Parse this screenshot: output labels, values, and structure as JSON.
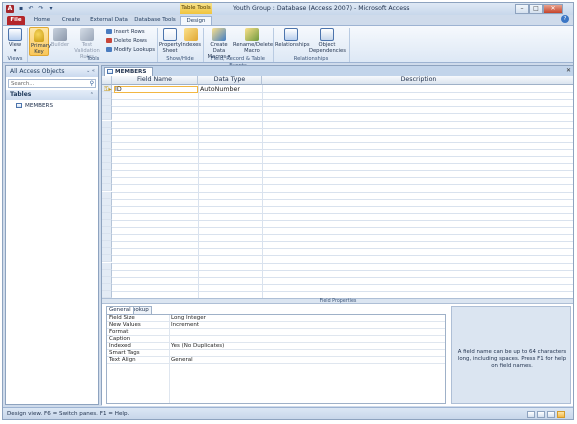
{
  "window": {
    "title": "Youth Group : Database (Access 2007) - Microsoft Access",
    "context_tab": "Table Tools",
    "app_icon": "A",
    "controls": {
      "minimize": "–",
      "maximize": "□",
      "close": "✕"
    }
  },
  "ribbon_tabs": [
    {
      "label": "File"
    },
    {
      "label": "Home"
    },
    {
      "label": "Create"
    },
    {
      "label": "External Data"
    },
    {
      "label": "Database Tools"
    },
    {
      "label": "Design"
    }
  ],
  "ribbon": {
    "views": {
      "view_label": "View",
      "group_label": "Views"
    },
    "tools": {
      "primary_key": "Primary Key",
      "builder": "Builder",
      "test_validation": "Test Validation Rules",
      "insert_rows": "Insert Rows",
      "delete_rows": "Delete Rows",
      "modify_lookups": "Modify Lookups",
      "group_label": "Tools"
    },
    "show_hide": {
      "property_sheet": "Property Sheet",
      "indexes": "Indexes",
      "group_label": "Show/Hide"
    },
    "field_events": {
      "create_macros": "Create Data Macros ▾",
      "rename_delete": "Rename/Delete Macro",
      "group_label": "Field, Record & Table Events"
    },
    "relationships": {
      "relationships": "Relationships",
      "object_dependencies": "Object Dependencies",
      "group_label": "Relationships"
    }
  },
  "nav": {
    "header": "All Access Objects",
    "header_tools": "⌄ «",
    "search_placeholder": "Search...",
    "group": "Tables",
    "group_chevron": "⌃",
    "items": [
      {
        "label": "MEMBERS"
      }
    ]
  },
  "document": {
    "tab_label": "MEMBERS",
    "close": "✕",
    "columns": [
      "Field Name",
      "Data Type",
      "Description"
    ],
    "rows": [
      {
        "field_name": "ID",
        "data_type": "AutoNumber",
        "description": ""
      }
    ]
  },
  "field_properties": {
    "bar_label": "Field Properties",
    "tabs": [
      "General",
      "Lookup"
    ],
    "rows": [
      {
        "label": "Field Size",
        "value": "Long Integer"
      },
      {
        "label": "New Values",
        "value": "Increment"
      },
      {
        "label": "Format",
        "value": ""
      },
      {
        "label": "Caption",
        "value": ""
      },
      {
        "label": "Indexed",
        "value": "Yes (No Duplicates)"
      },
      {
        "label": "Smart Tags",
        "value": ""
      },
      {
        "label": "Text Align",
        "value": "General"
      }
    ],
    "help_text": "A field name can be up to 64 characters long, including spaces. Press F1 for help on field names."
  },
  "status": {
    "text": "Design view.  F6 = Switch panes.  F1 = Help."
  },
  "colors": {
    "file_tab": "#b4262a",
    "accent": "#f9c75b",
    "chrome": "#cfdbeb"
  }
}
